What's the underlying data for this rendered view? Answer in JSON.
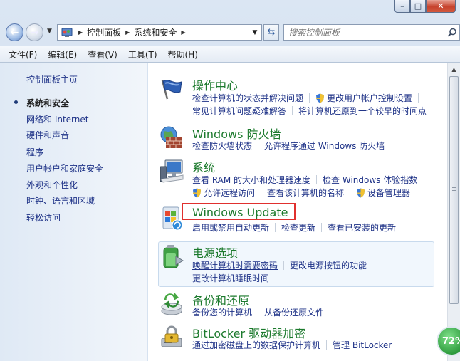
{
  "window": {
    "caption": {
      "minimize": "–",
      "maximize": "□",
      "close": "✕"
    }
  },
  "address_bar": {
    "crumbs": [
      "控制面板",
      "系统和安全"
    ],
    "search_placeholder": "搜索控制面板"
  },
  "menubar": {
    "items": [
      "文件(F)",
      "编辑(E)",
      "查看(V)",
      "工具(T)",
      "帮助(H)"
    ]
  },
  "left_pane": {
    "items": [
      {
        "label": "控制面板主页",
        "current": false
      },
      {
        "label": "系统和安全",
        "current": true
      },
      {
        "label": "网络和 Internet",
        "current": false
      },
      {
        "label": "硬件和声音",
        "current": false
      },
      {
        "label": "程序",
        "current": false
      },
      {
        "label": "用户帐户和家庭安全",
        "current": false
      },
      {
        "label": "外观和个性化",
        "current": false
      },
      {
        "label": "时钟、语言和区域",
        "current": false
      },
      {
        "label": "轻松访问",
        "current": false
      }
    ]
  },
  "categories": [
    {
      "title": "操作中心",
      "icon": "flag-icon",
      "rows": [
        [
          "检查计算机的状态并解决问题",
          "更改用户帐户控制设置"
        ],
        [
          "常见计算机问题疑难解答",
          "将计算机还原到一个较早的时间点"
        ]
      ]
    },
    {
      "title": "Windows 防火墙",
      "icon": "firewall-icon",
      "rows": [
        [
          "检查防火墙状态",
          "允许程序通过 Windows 防火墙"
        ]
      ]
    },
    {
      "title": "系统",
      "icon": "computer-icon",
      "rows": [
        [
          "查看 RAM 的大小和处理器速度",
          "检查 Windows 体验指数"
        ],
        [
          "允许远程访问",
          "查看该计算机的名称",
          "设备管理器"
        ]
      ]
    },
    {
      "title": "Windows Update",
      "icon": "windows-update-icon",
      "rows": [
        [
          "启用或禁用自动更新",
          "检查更新",
          "查看已安装的更新"
        ]
      ]
    },
    {
      "title": "电源选项",
      "icon": "battery-icon",
      "rows": [
        [
          "唤醒计算机时需要密码",
          "更改电源按钮的功能"
        ],
        [
          "更改计算机睡眠时间"
        ]
      ]
    },
    {
      "title": "备份和还原",
      "icon": "backup-icon",
      "rows": [
        [
          "备份您的计算机",
          "从备份还原文件"
        ]
      ]
    },
    {
      "title": "BitLocker 驱动器加密",
      "icon": "bitlocker-lock-icon",
      "rows": [
        [
          "通过加密磁盘上的数据保护计算机",
          "管理 BitLocker"
        ]
      ]
    }
  ],
  "badge": {
    "text": "72%"
  },
  "colors": {
    "category_title": "#1c7a2d",
    "link": "#1e3287",
    "highlight_border": "#e0302e"
  }
}
